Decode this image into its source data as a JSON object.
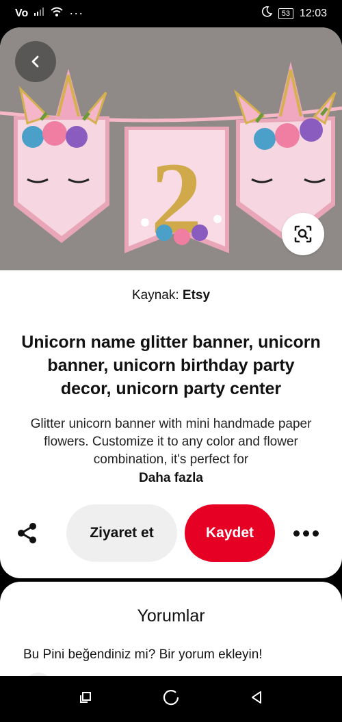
{
  "status_bar": {
    "carrier": "Vo",
    "more": "···",
    "battery": "53",
    "time": "12:03"
  },
  "pin": {
    "source_label": "Kaynak:",
    "source_name": "Etsy",
    "title": "Unicorn name glitter banner, unicorn banner, unicorn birthday party decor, unicorn party center",
    "description": "Glitter unicorn banner with mini handmade paper flowers. Customize it to any color and flower combination, it's perfect for",
    "more_link": "Daha fazla"
  },
  "actions": {
    "visit_label": "Ziyaret et",
    "save_label": "Kaydet"
  },
  "comments": {
    "title": "Yorumlar",
    "prompt": "Bu Pini beğendiniz mi? Bir yorum ekleyin!"
  },
  "hero_image": {
    "banner_digit": "2"
  },
  "colors": {
    "save_red": "#e60023",
    "visit_gray": "#efefef",
    "banner_pink": "#f4c9d6",
    "glitter_gold": "#cfa94a"
  }
}
